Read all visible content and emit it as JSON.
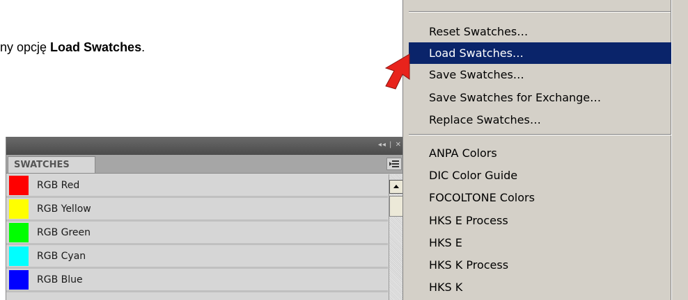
{
  "instruction": {
    "prefix": "ny opcję ",
    "bold": "Load Swatches",
    "suffix": "."
  },
  "panel": {
    "controls": "◂◂ | ✕",
    "tab_label": "SWATCHES",
    "swatches": [
      {
        "label": "RGB Red",
        "color": "#ff0000"
      },
      {
        "label": "RGB Yellow",
        "color": "#ffff00"
      },
      {
        "label": "RGB Green",
        "color": "#00ff00"
      },
      {
        "label": "RGB Cyan",
        "color": "#00ffff"
      },
      {
        "label": "RGB Blue",
        "color": "#0000ff"
      }
    ]
  },
  "menu": {
    "items": [
      {
        "label": "Reset Swatches…"
      },
      {
        "label": "Load Swatches…",
        "highlighted": true
      },
      {
        "label": "Save Swatches…"
      },
      {
        "label": "Save Swatches for Exchange…"
      },
      {
        "label": "Replace Swatches…"
      },
      {
        "label": "ANPA Colors"
      },
      {
        "label": "DIC Color Guide"
      },
      {
        "label": "FOCOLTONE Colors"
      },
      {
        "label": "HKS E Process"
      },
      {
        "label": "HKS E"
      },
      {
        "label": "HKS K Process"
      },
      {
        "label": "HKS K"
      }
    ],
    "highlight_color": "#0a246a"
  },
  "arrow_color": "#e8231c"
}
